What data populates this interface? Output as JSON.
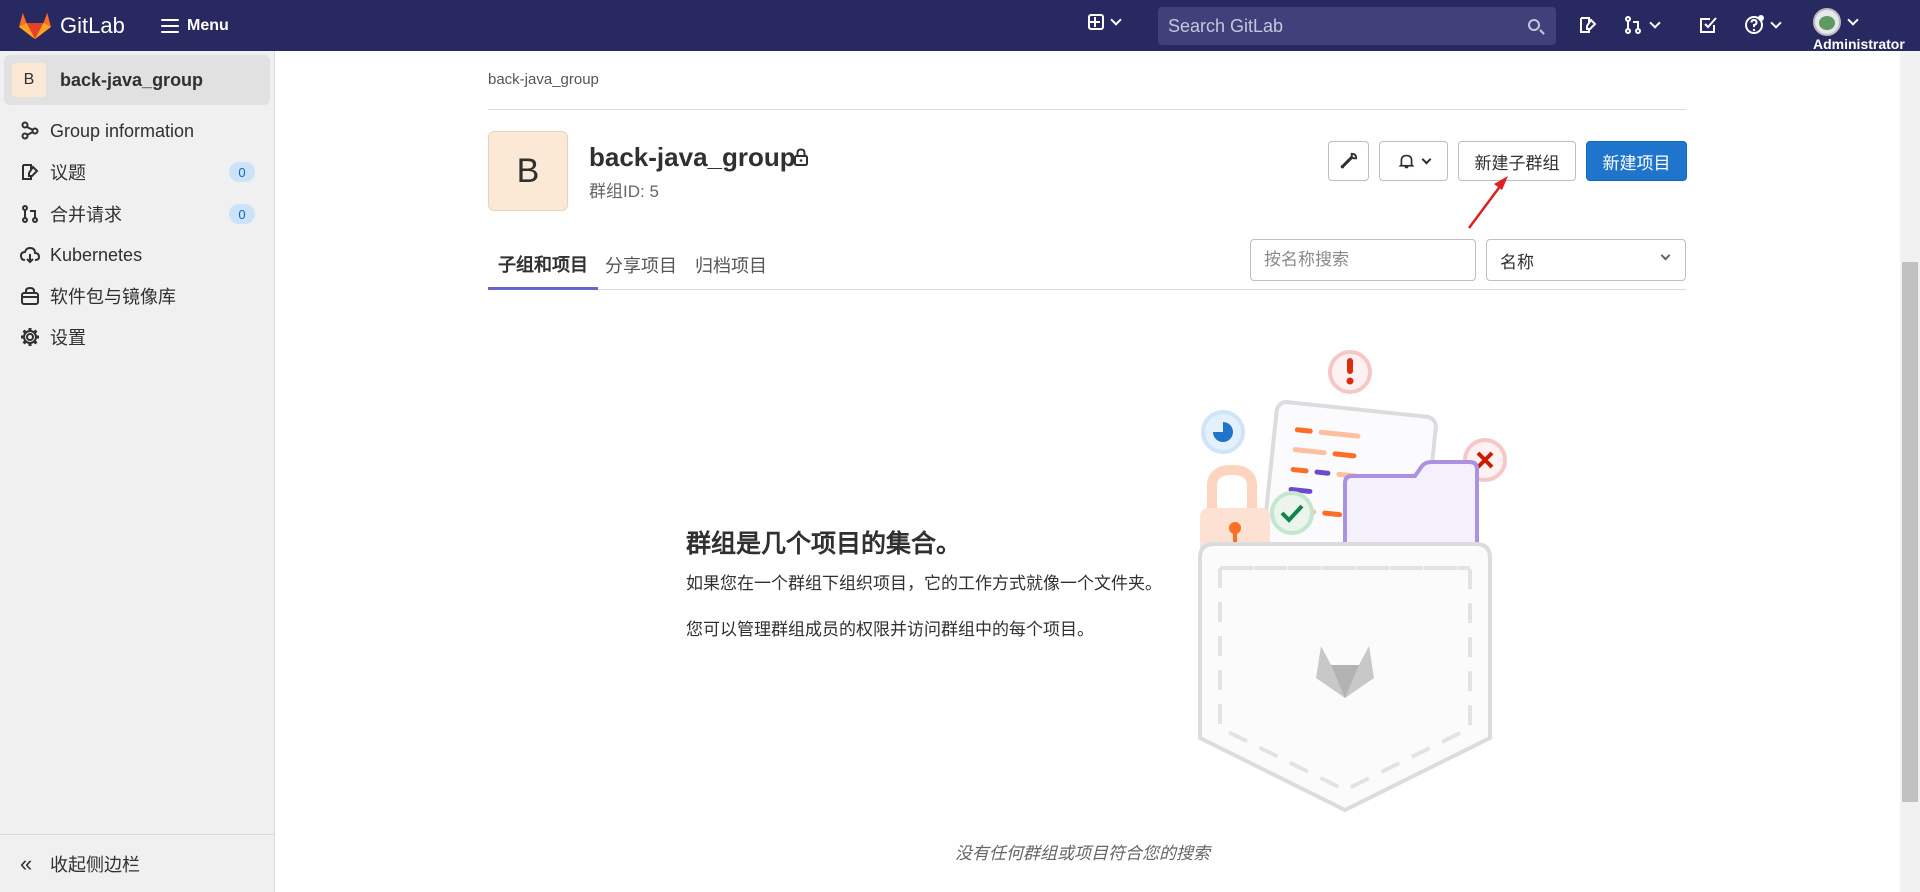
{
  "navbar": {
    "brand": "GitLab",
    "menu_label": "Menu",
    "search_placeholder": "Search GitLab",
    "user_label": "Administrator"
  },
  "sidebar": {
    "group_initial": "B",
    "group_name": "back-java_group",
    "items": [
      {
        "label": "Group information",
        "icon": "group-info-icon"
      },
      {
        "label": "议题",
        "icon": "issues-icon",
        "count": "0"
      },
      {
        "label": "合并请求",
        "icon": "merge-request-icon",
        "count": "0"
      },
      {
        "label": "Kubernetes",
        "icon": "kubernetes-icon"
      },
      {
        "label": "软件包与镜像库",
        "icon": "package-icon"
      },
      {
        "label": "设置",
        "icon": "settings-icon"
      }
    ],
    "collapse_label": "收起侧边栏"
  },
  "main": {
    "breadcrumb": "back-java_group",
    "group_initial": "B",
    "group_title": "back-java_group",
    "group_id": "群组ID: 5",
    "buttons": {
      "new_subgroup": "新建子群组",
      "new_project": "新建项目"
    },
    "tabs": [
      "子组和项目",
      "分享项目",
      "归档项目"
    ],
    "filter_placeholder": "按名称搜索",
    "sort_selected": "名称",
    "empty_state": {
      "title": "群组是几个项目的集合。",
      "line1": "如果您在一个群组下组织项目，它的工作方式就像一个文件夹。",
      "line2": "您可以管理群组成员的权限并访问群组中的每个项目。"
    },
    "no_results": "没有任何群组或项目符合您的搜索"
  },
  "colors": {
    "navbar_bg": "#292961",
    "primary": "#1f75cb",
    "tab_active_underline": "#6666c4",
    "annotation_arrow": "#e02020"
  }
}
